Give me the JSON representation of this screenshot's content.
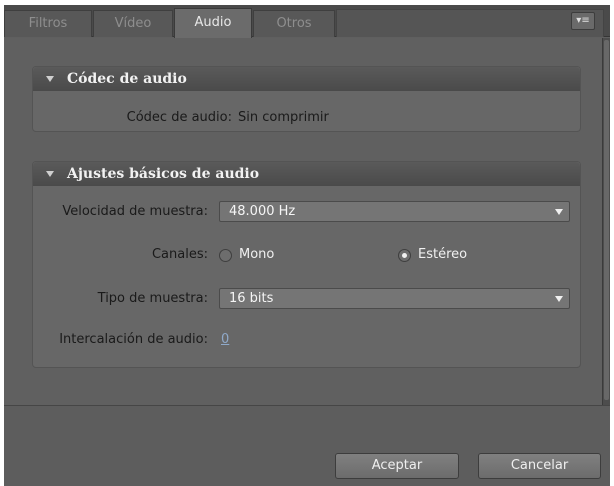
{
  "tabs": [
    {
      "label": "Filtros",
      "active": false
    },
    {
      "label": "Vídeo",
      "active": false
    },
    {
      "label": "Audio",
      "active": true
    },
    {
      "label": "Otros",
      "active": false
    }
  ],
  "panel_menu_icon": "panel-menu-icon",
  "codec_section": {
    "title": "Códec de audio",
    "codec_label": "Códec de audio:",
    "codec_value": "Sin comprimir"
  },
  "basic_section": {
    "title": "Ajustes básicos de audio",
    "sample_rate_label": "Velocidad de muestra:",
    "sample_rate_value": "48.000 Hz",
    "channels_label": "Canales:",
    "channel_mono": "Mono",
    "channel_stereo": "Estéreo",
    "channel_selected": "Estéreo",
    "sample_type_label": "Tipo de muestra:",
    "sample_type_value": "16 bits",
    "interleave_label": "Intercalación de audio:",
    "interleave_value": "0"
  },
  "buttons": {
    "accept": "Aceptar",
    "cancel": "Cancelar"
  },
  "colors": {
    "panel_bg": "#606060",
    "header": "#4a4a4a",
    "link": "#8fa9c9"
  }
}
